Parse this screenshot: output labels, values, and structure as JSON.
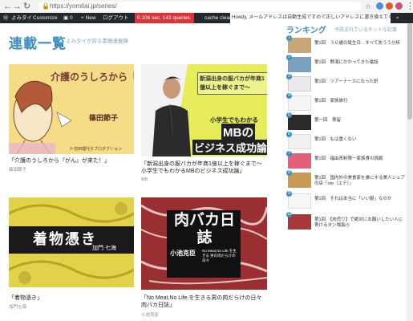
{
  "browser": {
    "url": "https://yomitai.jp/series/"
  },
  "adminbar": {
    "items": [
      "よみタイ",
      "Customize",
      "0",
      "+ New",
      "ログアウト"
    ],
    "queries": "0.106 sec. 143 queries.",
    "cache": "cache clear",
    "notice": "Howdy, メールアドレスは自動生成ですので正しいアドレスに書き換えてください。"
  },
  "page": {
    "title": "連載一覧",
    "subtitle": "よみタイが誇る素敵連載陣"
  },
  "cards": [
    {
      "title": "「介護のうしろから『がん』が来た！」",
      "author": "篠田節子",
      "art_main": "介護のうしろから「がん」が来た！",
      "art_author": "篠田節子",
      "art_credit": "© 岩田理代子プロダクション"
    },
    {
      "title": "「新潟出身の服バカが年商1億以上を稼ぐまで〜　小学生でもわかるMBのビジネス成功論」",
      "author": "MB",
      "art_top": "新潟出身の服バカが年商1億以上を稼ぐまで〜",
      "art_mid": "小学生でもわかる",
      "art_big": "MBの",
      "art_big2": "ビジネス成功論"
    },
    {
      "title": "「着物憑き」",
      "author": "加門七海",
      "art_main": "着物憑き",
      "art_author": "加門 七海"
    },
    {
      "title": "「No Meat,No Life.を生きる男の肉だらけの日々　肉バカ日誌」",
      "author": "小池克臣",
      "art_main": "肉バカ日誌",
      "art_name": "小池克臣",
      "art_sub": "No Meat,No Life.を生きる 男の肉だらけの日々"
    }
  ],
  "ranking": {
    "title": "ランキング",
    "subtitle": "今読まれているホットな記事",
    "items": [
      {
        "num": "1",
        "text": "第1回　３０歳の誕生日…すべて失うう分析"
      },
      {
        "num": "2",
        "text": "第1回　野湯にかかってきた電話"
      },
      {
        "num": "3",
        "text": "第1回　ツアーナースになった訳"
      },
      {
        "num": "4",
        "text": "第1回　家族旅行"
      },
      {
        "num": "5",
        "text": "第一回　寄留"
      },
      {
        "num": "6",
        "text": "第1回　もは重くない"
      },
      {
        "num": "7",
        "text": "第1回　福由青制限一家族食の挑戦"
      },
      {
        "num": "8",
        "text": "第1回　国内外の美食家を虜にする美人シェアの店「ote（エテ）」"
      },
      {
        "num": "9",
        "text": "第1回　それは本当に「いい服」なのか"
      },
      {
        "num": "10",
        "text": "第1回　【肉売り】で絶対にお願いしたい人に寄けるタン場長(!)"
      }
    ]
  },
  "colors": {
    "accent": "#3a8fc0",
    "adminbar": "#23282d"
  }
}
